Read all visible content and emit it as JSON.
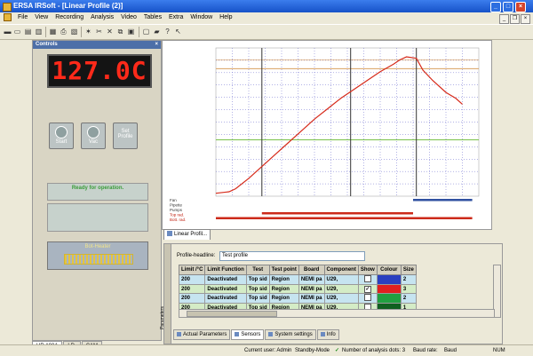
{
  "window": {
    "title": "ERSA IRSoft - [Linear Profile (2)]"
  },
  "menu": [
    "File",
    "View",
    "Recording",
    "Analysis",
    "Video",
    "Tables",
    "Extra",
    "Window",
    "Help"
  ],
  "controls": {
    "title": "Controls",
    "display": "127.0C",
    "buttons": [
      "Start",
      "Vac",
      "Set Profile"
    ],
    "status": "Ready for operation.",
    "heater_label": "Bot-Heater"
  },
  "chart_data": {
    "type": "line",
    "series": [
      {
        "values": [
          [
            0,
            2
          ],
          [
            4,
            3
          ],
          [
            6,
            5
          ],
          [
            10,
            12
          ],
          [
            14,
            20
          ],
          [
            18,
            28
          ],
          [
            22,
            36
          ],
          [
            26,
            44
          ],
          [
            30,
            52
          ],
          [
            34,
            59
          ],
          [
            38,
            66
          ],
          [
            42,
            72
          ],
          [
            46,
            78
          ],
          [
            50,
            84
          ],
          [
            54,
            89
          ],
          [
            56,
            92
          ],
          [
            58,
            94
          ],
          [
            61,
            93
          ],
          [
            63,
            85
          ],
          [
            66,
            78
          ],
          [
            70,
            70
          ],
          [
            73,
            66
          ],
          [
            75,
            62
          ]
        ]
      }
    ],
    "colors": {
      "line": "#d62a1a",
      "vline": "#333333",
      "grid": "#6666cc",
      "limit_upper": "#d9a060",
      "limit_lower": "#7ac24a"
    },
    "row_labels": [
      "Fan",
      "Pipette",
      "Pumps",
      "Top rad.",
      "Bott. rad."
    ],
    "bar_colors": {
      "top": "#cc2a1a",
      "bott": "#cc2a1a",
      "fan": "#3050a0"
    }
  },
  "profile_tab": "Linear Profil...",
  "parameters": {
    "headline_label": "Profile-headline:",
    "headline_value": "Test profile",
    "columns": [
      "Limit /°C",
      "Limit Function",
      "Test",
      "Test point",
      "Board",
      "Component",
      "Show",
      "Colour",
      "Size"
    ],
    "rows": [
      [
        "200",
        "Deactivated",
        "Top sid",
        "Region",
        "NEMI pa",
        "U29,",
        "",
        "#2a40c0",
        "2"
      ],
      [
        "200",
        "Deactivated",
        "Top sid",
        "Region",
        "NEMI pa",
        "U29,",
        "✓",
        "#e02020",
        "3"
      ],
      [
        "200",
        "Deactivated",
        "Top sid",
        "Region",
        "NEMI pa",
        "U29,",
        "",
        "#20a040",
        "2"
      ],
      [
        "200",
        "Deactivated",
        "Top sid",
        "Region",
        "NEMI pa",
        "U29,",
        "",
        "#106020",
        "1"
      ]
    ],
    "side_label": "Parameters",
    "tabs": [
      "Actual Parameters",
      "Sensors",
      "System settings",
      "Info"
    ]
  },
  "bottom_tabs": [
    "HR 100A",
    "LD.",
    "CAM"
  ],
  "statusbar": {
    "user": "Current user: Admin",
    "mode": "Standby-Mode",
    "dots": "Number of analysis dots: 3",
    "baud_label": "Baud rate:",
    "baud": "Baud",
    "num": "NUM"
  }
}
